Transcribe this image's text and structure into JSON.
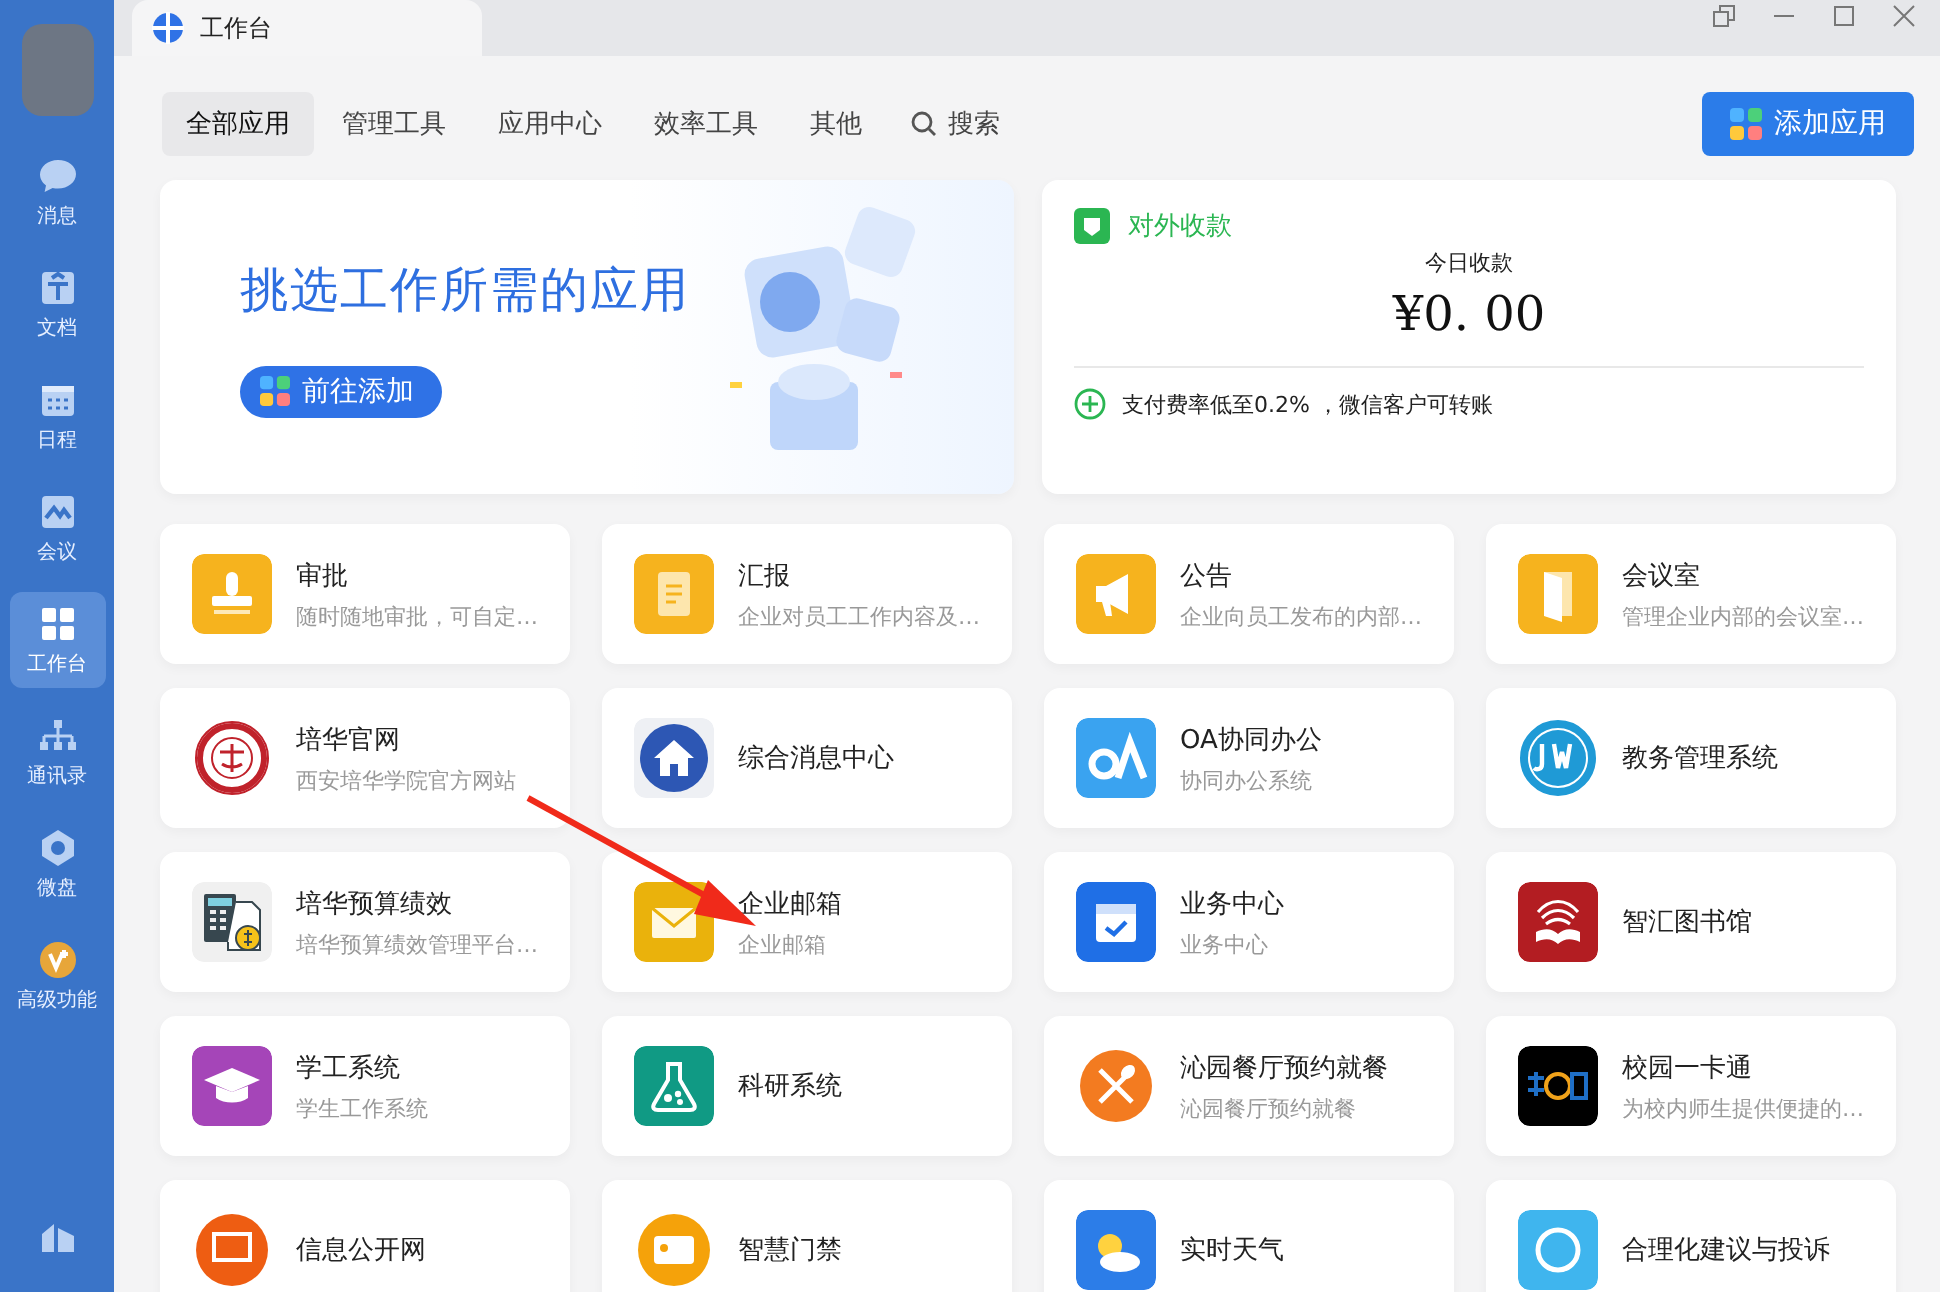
{
  "window": {
    "tab_title": "工作台"
  },
  "sidebar": {
    "items": [
      {
        "label": "消息",
        "kind": "chat",
        "selected": false
      },
      {
        "label": "文档",
        "kind": "doc",
        "selected": false
      },
      {
        "label": "日程",
        "kind": "calendar",
        "selected": false
      },
      {
        "label": "会议",
        "kind": "meeting",
        "selected": false
      },
      {
        "label": "工作台",
        "kind": "grid",
        "selected": true
      },
      {
        "label": "通讯录",
        "kind": "org",
        "selected": false
      },
      {
        "label": "微盘",
        "kind": "disk",
        "selected": false
      },
      {
        "label": "高级功能",
        "kind": "vip",
        "selected": false
      }
    ]
  },
  "filters": [
    {
      "label": "全部应用",
      "selected": true
    },
    {
      "label": "管理工具",
      "selected": false
    },
    {
      "label": "应用中心",
      "selected": false
    },
    {
      "label": "效率工具",
      "selected": false
    },
    {
      "label": "其他",
      "selected": false
    }
  ],
  "search": {
    "label": "搜索"
  },
  "add_button": {
    "label": "添加应用"
  },
  "banner": {
    "headline": "挑选工作所需的应用",
    "button": "前往添加"
  },
  "payment": {
    "title": "对外收款",
    "caption": "今日收款",
    "amount": "¥0. 00",
    "note": "支付费率低至0.2% ，微信客户可转账"
  },
  "apps": [
    {
      "title": "审批",
      "desc": "随时随地审批，可自定…",
      "kind": "stamp",
      "color": "#f6b31e"
    },
    {
      "title": "汇报",
      "desc": "企业对员工工作内容及…",
      "kind": "report",
      "color": "#f6b31e"
    },
    {
      "title": "公告",
      "desc": "企业向员工发布的内部…",
      "kind": "megaphone",
      "color": "#f6b31e"
    },
    {
      "title": "会议室",
      "desc": "管理企业内部的会议室…",
      "kind": "door",
      "color": "#f6b31e"
    },
    {
      "title": "培华官网",
      "desc": "西安培华学院官方网站",
      "kind": "seal",
      "color": "#c0222b"
    },
    {
      "title": "综合消息中心",
      "kind": "house",
      "color": "#2d57b4"
    },
    {
      "title": "OA协同办公",
      "desc": "协同办公系统",
      "kind": "oa",
      "color": "#3aa3f0"
    },
    {
      "title": "教务管理系统",
      "kind": "jw",
      "color": "#1f9ad6"
    },
    {
      "title": "培华预算绩效",
      "desc": "培华预算绩效管理平台…",
      "kind": "calc",
      "color": "#f0f0f0"
    },
    {
      "title": "企业邮箱",
      "desc": "企业邮箱",
      "kind": "mail",
      "color": "#eab20c"
    },
    {
      "title": "业务中心",
      "desc": "业务中心",
      "kind": "task",
      "color": "#1f6fe6"
    },
    {
      "title": "智汇图书馆",
      "kind": "library",
      "color": "#b31d22"
    },
    {
      "title": "学工系统",
      "desc": "学生工作系统",
      "kind": "cap",
      "color": "#a545b8"
    },
    {
      "title": "科研系统",
      "kind": "flask",
      "color": "#109a84"
    },
    {
      "title": "沁园餐厅预约就餐",
      "desc": "沁园餐厅预约就餐",
      "kind": "dining",
      "color": "#f37b20"
    },
    {
      "title": "校园一卡通",
      "desc": "为校内师生提供便捷的…",
      "kind": "ecard"
    },
    {
      "title": "信息公开网",
      "kind": "monitor",
      "color": "#ee5d12"
    },
    {
      "title": "智慧门禁",
      "kind": "idcard",
      "color": "#f5a20a"
    },
    {
      "title": "实时天气",
      "kind": "weather",
      "color": "#2c7de8"
    },
    {
      "title": "合理化建议与投诉",
      "kind": "bubble",
      "color": "#3fb5ee"
    }
  ]
}
